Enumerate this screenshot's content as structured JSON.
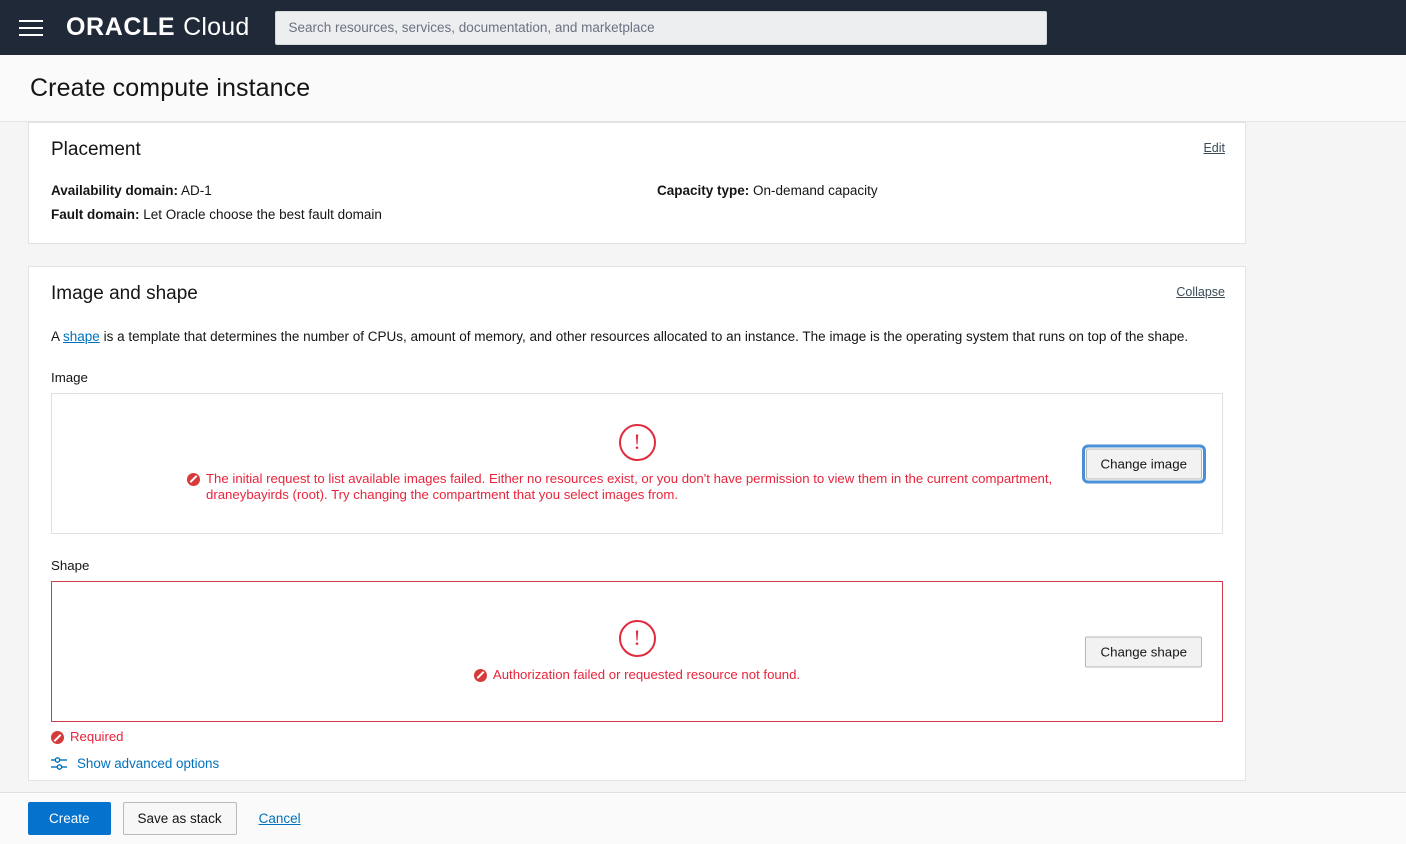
{
  "header": {
    "menu_icon": "hamburger-menu-icon",
    "brand_oracle": "ORACLE",
    "brand_cloud": "Cloud",
    "search_placeholder": "Search resources, services, documentation, and marketplace",
    "search_value": ""
  },
  "page": {
    "title": "Create compute instance"
  },
  "placement": {
    "title": "Placement",
    "edit_label": "Edit",
    "availability_domain_label": "Availability domain:",
    "availability_domain_value": "AD-1",
    "fault_domain_label": "Fault domain:",
    "fault_domain_value": "Let Oracle choose the best fault domain",
    "capacity_type_label": "Capacity type:",
    "capacity_type_value": "On-demand capacity"
  },
  "image_and_shape": {
    "title": "Image and shape",
    "collapse_label": "Collapse",
    "description_prefix": "A ",
    "description_link": "shape",
    "description_rest": " is a template that determines the number of CPUs, amount of memory, and other resources allocated to an instance. The image is the operating system that runs on top of the shape.",
    "image_label": "Image",
    "image_error_icon": "alert-circle-icon",
    "image_error_text": "The initial request to list available images failed. Either no resources exist, or you don't have permission to view them in the current compartment, draneybayirds (root). Try changing the compartment that you select images from.",
    "change_image_label": "Change image",
    "shape_label": "Shape",
    "shape_error_icon": "alert-circle-icon",
    "shape_error_text": "Authorization failed or requested resource not found.",
    "change_shape_label": "Change shape",
    "required_text": "Required",
    "advanced_options_label": "Show advanced options",
    "advanced_options_icon": "sliders-icon"
  },
  "footer": {
    "create_label": "Create",
    "save_as_stack_label": "Save as stack",
    "cancel_label": "Cancel"
  },
  "colors": {
    "navbar": "#1f2937",
    "error": "#e8243c",
    "link": "#0071bc",
    "primary_button": "#0572ce",
    "shape_box_border": "#cf3a4c",
    "focus_ring": "#4a90d9"
  }
}
